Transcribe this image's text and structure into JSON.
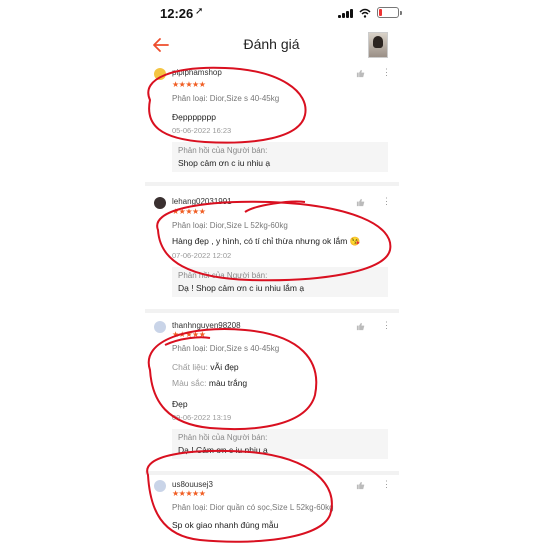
{
  "status_bar": {
    "time": "12:26"
  },
  "header": {
    "title": "Đánh giá",
    "back_icon": "arrow-left-icon",
    "accent": "#ee4d2d"
  },
  "colors": {
    "star": "#f05d23",
    "annotation": "#d91020"
  },
  "reviews": [
    {
      "username": "pipiphamshop",
      "stars": "★★★★★",
      "variant": "Phân loại: Dior,Size s 40-45kg",
      "comment": "Đẹppppppp",
      "date": "05-06-2022 16:23",
      "reply_label": "Phản hồi của Người bán:",
      "reply_text": "Shop cảm ơn c iu nhiu ạ"
    },
    {
      "username": "lehang02031991",
      "stars": "★★★★★",
      "variant": "Phân loại: Dior,Size L 52kg-60kg",
      "comment": "Hàng đẹp , y hình, có tí chỉ thừa nhưng ok lắm 😘",
      "date": "07-06-2022 12:02",
      "reply_label": "Phản hồi của Người bán:",
      "reply_text": "Dạ ! Shop cảm ơn c iu nhiu lắm ạ"
    },
    {
      "username": "thanhnguyen98208",
      "stars": "★★★★★",
      "variant": "Phân loại: Dior,Size s 40-45kg",
      "material_label": "Chất liệu:",
      "material_value": "vÃi đẹp",
      "color_label": "Màu sắc:",
      "color_value": "màu trắng",
      "comment": "Đẹp",
      "date": "09-06-2022 13:19",
      "reply_label": "Phản hồi của Người bán:",
      "reply_text": "Dạ ! Cảm ơn c iu nhiu ạ"
    },
    {
      "username": "us8ouusej3",
      "stars": "★★★★★",
      "variant": "Phân loại: Dior quần có sọc,Size L 52kg-60kg",
      "comment": "Sp ok giao nhanh đúng mẫu"
    }
  ]
}
